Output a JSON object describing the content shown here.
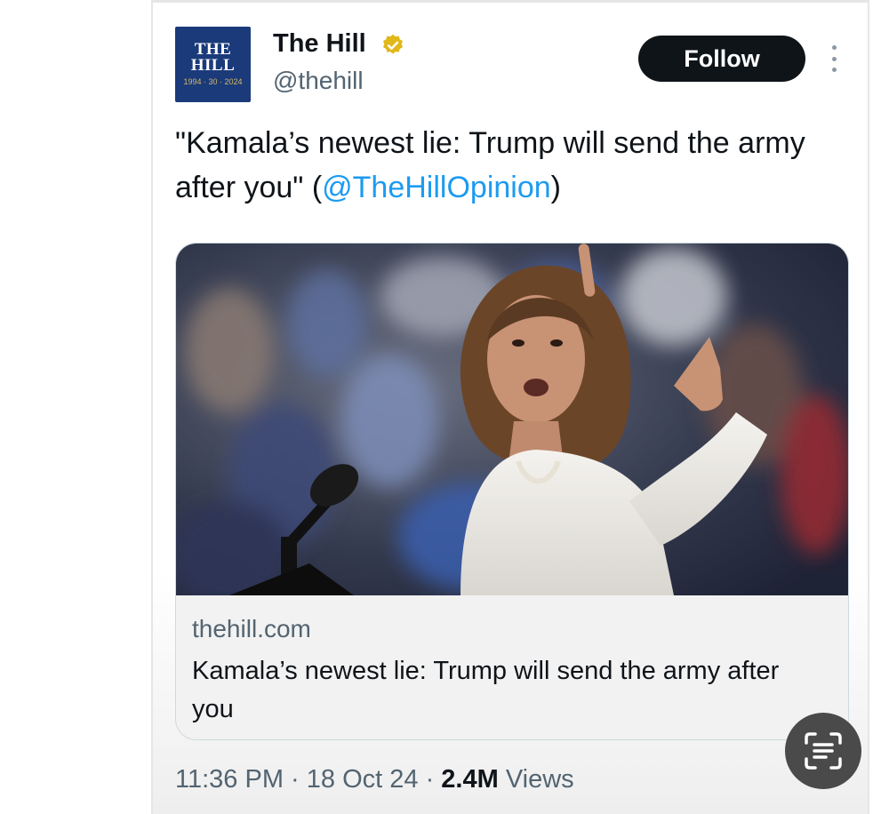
{
  "tweet": {
    "avatar": {
      "line1": "THE",
      "line2": "HILL",
      "sub": "1994 · 30 · 2024"
    },
    "display_name": "The Hill",
    "handle": "@thehill",
    "follow_label": "Follow",
    "text_before_mention": "\"Kamala’s newest lie: Trump will send the army after you\" (",
    "mention": "@TheHillOpinion",
    "text_after_mention": ")",
    "link_card": {
      "domain": "thehill.com",
      "title": "Kamala’s newest lie: Trump will send the army after you"
    },
    "meta": {
      "time": "11:36 PM",
      "separator": " · ",
      "date": "18 Oct 24",
      "views_count": "2.4M",
      "views_label": "Views"
    }
  },
  "icons": {
    "verified": "verified-badge-icon",
    "more": "more-options-icon",
    "lens": "text-scan-icon"
  },
  "colors": {
    "text": "#0f1419",
    "secondary": "#536471",
    "link": "#1d9bf0",
    "verified_gold": "#e2b719",
    "avatar_bg": "#1a3a7a",
    "follow_bg": "#0f1419"
  }
}
